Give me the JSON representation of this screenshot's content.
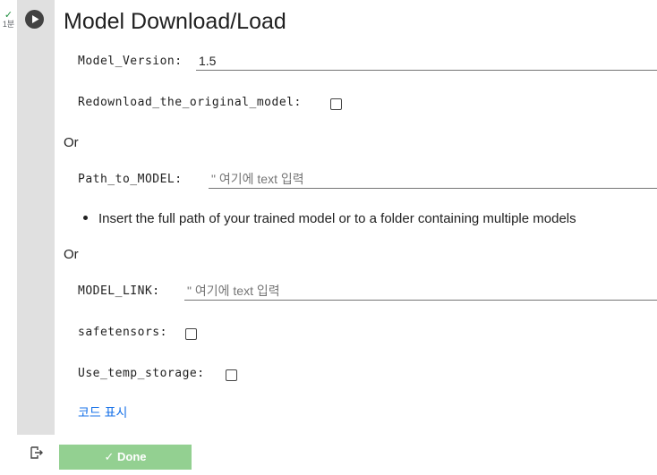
{
  "status": {
    "icon": "check-icon",
    "check_glyph": "✓",
    "time": "1분"
  },
  "run_button": {
    "icon": "play-icon"
  },
  "form": {
    "title": "Model Download/Load",
    "model_version": {
      "label": "Model_Version:",
      "value": "1.5"
    },
    "redownload": {
      "label": "Redownload_the_original_model:",
      "checked": false
    },
    "or1": "Or",
    "path_to_model": {
      "label": "Path_to_MODEL:",
      "placeholder": "\" 여기에 text 입력"
    },
    "bullet": "Insert the full path of your trained model or to a folder containing multiple models",
    "or2": "Or",
    "model_link": {
      "label": "MODEL_LINK:",
      "placeholder": "\" 여기에 text 입력"
    },
    "safetensors": {
      "label": "safetensors:",
      "checked": false
    },
    "use_temp_storage": {
      "label": "Use_temp_storage:",
      "checked": false
    },
    "show_code": "코드 표시"
  },
  "output": {
    "icon": "output-redirect-icon",
    "done_label": "✓ Done"
  }
}
